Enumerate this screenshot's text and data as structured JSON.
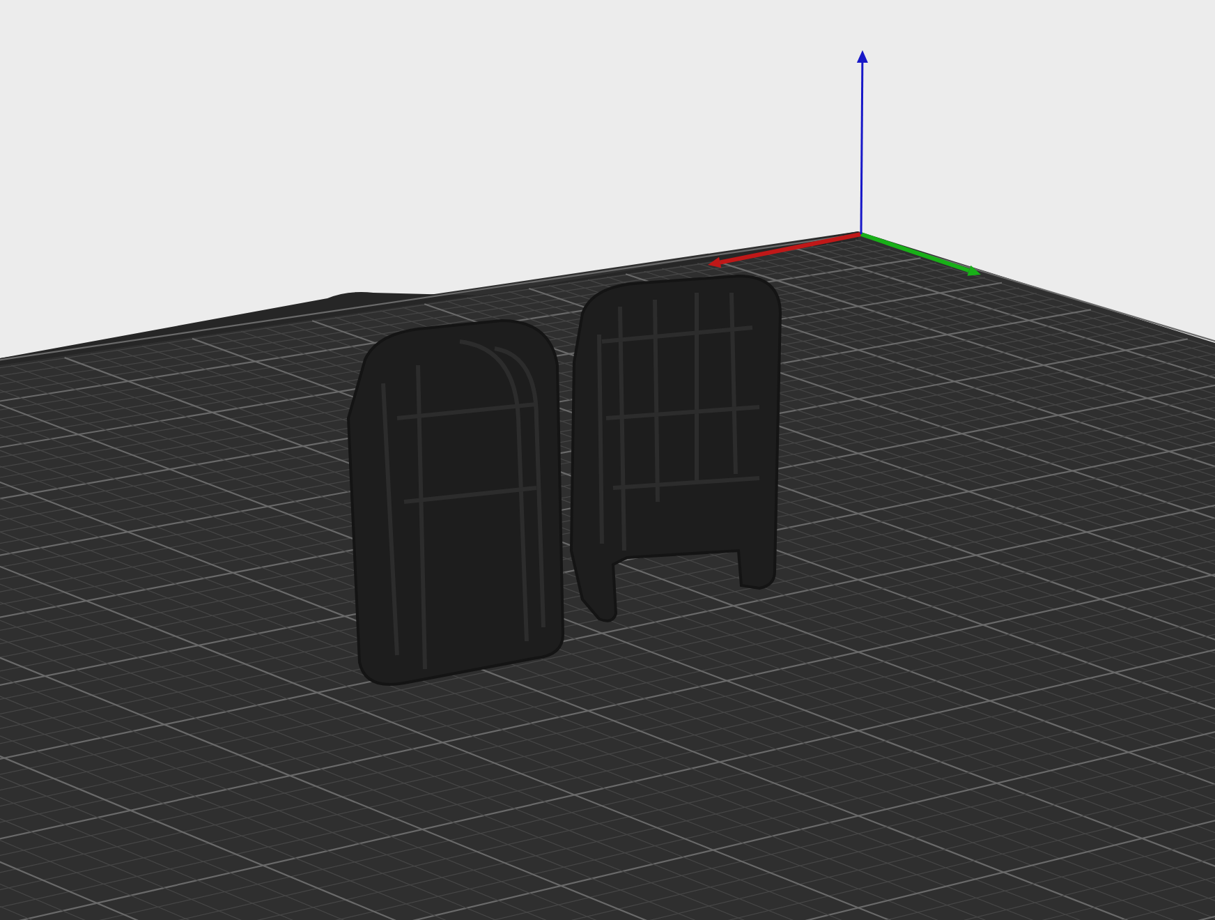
{
  "viewport": {
    "kind": "build-plate",
    "axes": [
      {
        "kind": "x",
        "color": "#c01818"
      },
      {
        "kind": "y",
        "color": "#18b018"
      },
      {
        "kind": "z",
        "color": "#1818c8"
      }
    ],
    "models": [
      {
        "kind": "cover-piece"
      },
      {
        "kind": "cover-piece-notched"
      }
    ]
  }
}
